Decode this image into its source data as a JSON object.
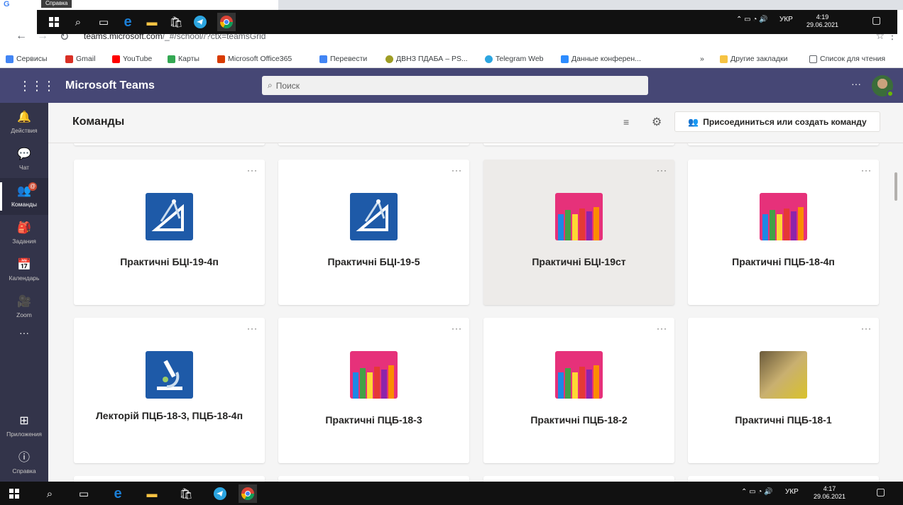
{
  "browser": {
    "tab_letter": "G",
    "tooltip": "Справка",
    "url_host": "teams.microsoft.com",
    "url_path": "/_#/school//?ctx=teamsGrid",
    "bookmarks": [
      {
        "label": "Сервисы",
        "color": "#ea4335"
      },
      {
        "label": "Gmail",
        "color": "#d93025"
      },
      {
        "label": "YouTube",
        "color": "#ff0000"
      },
      {
        "label": "Карты",
        "color": "#34a853"
      },
      {
        "label": "Microsoft Office365",
        "color": "#d83b01"
      },
      {
        "label": "Перевести",
        "color": "#4285f4"
      },
      {
        "label": "ДВНЗ ПДАБА – PS...",
        "color": "#9e9d24"
      },
      {
        "label": "Telegram Web",
        "color": "#2ca5e0"
      },
      {
        "label": "Данные конферен...",
        "color": "#2d8cff"
      }
    ],
    "more_bookmarks": "»",
    "other_bookmarks": "Другие закладки",
    "reading_list": "Список для чтения"
  },
  "overlay_taskbar": {
    "lang": "УКР",
    "time": "4:19",
    "date": "29.06.2021"
  },
  "teams": {
    "app_title": "Microsoft Teams",
    "search_placeholder": "Поиск",
    "more": "···"
  },
  "rail": {
    "items": [
      {
        "label": "Действия",
        "icon": "bell-icon",
        "glyph": "🔔"
      },
      {
        "label": "Чат",
        "icon": "chat-icon",
        "glyph": "💬"
      },
      {
        "label": "Команды",
        "icon": "teams-icon",
        "glyph": "👥",
        "badge": "@"
      },
      {
        "label": "Задания",
        "icon": "assignments-icon",
        "glyph": "🎒"
      },
      {
        "label": "Календарь",
        "icon": "calendar-icon",
        "glyph": "📅"
      },
      {
        "label": "Zoom",
        "icon": "video-icon",
        "glyph": "🎥"
      }
    ],
    "more": "···",
    "apps_label": "Приложения",
    "help_label": "Справка"
  },
  "content": {
    "title": "Команды",
    "join_button": "Присоединиться или создать команду",
    "cards": [
      {
        "name": "Практичні БЦІ-19-4п",
        "logo": "geometry-icon"
      },
      {
        "name": "Практичні БЦІ-19-5",
        "logo": "geometry-icon"
      },
      {
        "name": "Практичні БЦІ-19ст",
        "logo": "pencils-icon"
      },
      {
        "name": "Практичні ПЦБ-18-4п",
        "logo": "pencils-icon"
      },
      {
        "name": "Лекторій ПЦБ-18-3, ПЦБ-18-4п",
        "logo": "microscope-icon"
      },
      {
        "name": "Практичні ПЦБ-18-3",
        "logo": "pencils-icon"
      },
      {
        "name": "Практичні ПЦБ-18-2",
        "logo": "pencils-icon"
      },
      {
        "name": "Практичні ПЦБ-18-1",
        "logo": "photo"
      }
    ]
  },
  "taskbar": {
    "lang": "УКР",
    "time": "4:17",
    "date": "29.06.2021"
  }
}
